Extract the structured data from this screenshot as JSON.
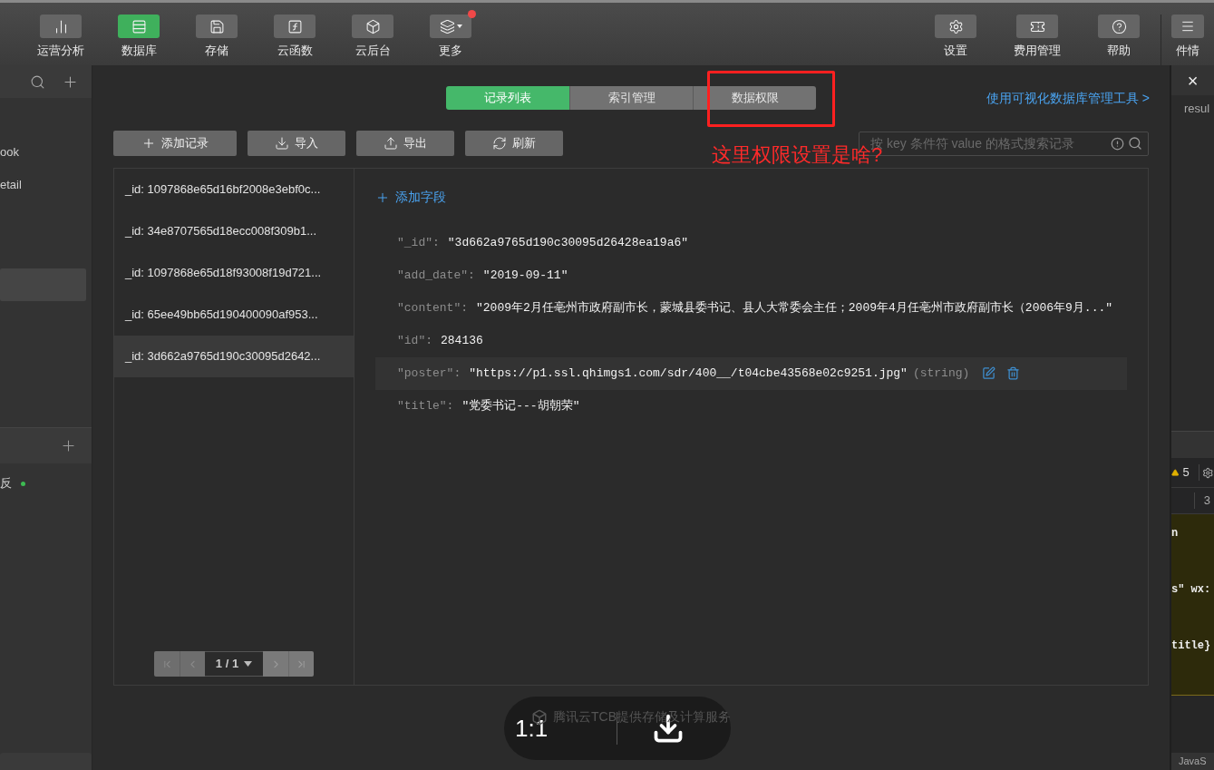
{
  "toolbar": {
    "left": [
      {
        "label": "运营分析",
        "selected": false
      },
      {
        "label": "数据库",
        "selected": true
      },
      {
        "label": "存储",
        "selected": false
      },
      {
        "label": "云函数",
        "selected": false
      },
      {
        "label": "云后台",
        "selected": false
      },
      {
        "label": "更多",
        "selected": false,
        "dropdown": true,
        "badge": true
      }
    ],
    "right": [
      {
        "label": "设置",
        "selected": false
      },
      {
        "label": "费用管理",
        "selected": false
      },
      {
        "label": "帮助",
        "selected": false
      },
      {
        "label": "件情",
        "selected": false
      }
    ]
  },
  "sidebar": {
    "items": [
      {
        "label": "ook",
        "selected": false
      },
      {
        "label": "etail",
        "selected": false
      },
      {
        "selected": true
      }
    ],
    "section_items": [
      {
        "label": "反",
        "color": "#3dbb52"
      }
    ]
  },
  "tabs": [
    {
      "label": "记录列表",
      "selected": true
    },
    {
      "label": "索引管理",
      "selected": false
    },
    {
      "label": "数据权限",
      "selected": false
    }
  ],
  "tool_link": "使用可视化数据库管理工具 >",
  "annotation": {
    "text": "这里权限设置是啥?"
  },
  "actions": [
    {
      "label": "添加记录"
    },
    {
      "label": "导入"
    },
    {
      "label": "导出"
    },
    {
      "label": "刷新"
    }
  ],
  "search": {
    "placeholder": "按 key 条件符 value 的格式搜索记录"
  },
  "records": [
    {
      "label": "_id: 1097868e65d16bf2008e3ebf0c...",
      "selected": false
    },
    {
      "label": "_id: 34e8707565d18ecc008f309b1...",
      "selected": false
    },
    {
      "label": "_id: 1097868e65d18f93008f19d721...",
      "selected": false
    },
    {
      "label": "_id: 65ee49bb65d190400090af953...",
      "selected": false
    },
    {
      "label": "_id: 3d662a9765d190c30095d2642...",
      "selected": true
    }
  ],
  "pagination": {
    "page": "1 / 1"
  },
  "add_field": "添加字段",
  "fields": [
    {
      "key": "\"_id\":",
      "value": "\"3d662a9765d190c30095d26428ea19a6\"",
      "hovered": false
    },
    {
      "key": "\"add_date\":",
      "value": "\"2019-09-11\"",
      "hovered": false
    },
    {
      "key": "\"content\":",
      "value": "\"2009年2月任亳州市政府副市长，蒙城县委书记、县人大常委会主任；2009年4月任亳州市政府副市长（2006年9月...\"",
      "hovered": false
    },
    {
      "key": "\"id\":",
      "value": "284136",
      "hovered": false
    },
    {
      "key": "\"poster\":",
      "value": "\"https://p1.ssl.qhimgs1.com/sdr/400__/t04cbe43568e02c9251.jpg\"",
      "type": "(string)",
      "hovered": true
    },
    {
      "key": "\"title\":",
      "value": "\"党委书记---胡朝荣\"",
      "hovered": false
    }
  ],
  "footer": "腾讯云TCB提供存储及计算服务",
  "viewer": {
    "zoom": "1:1"
  },
  "right_panel": {
    "close": "×",
    "tab_text": "resul",
    "warnings": "5",
    "count": "3",
    "code_lines": [
      "n",
      "s\" wx:",
      "title}"
    ],
    "status": "JavaS"
  }
}
